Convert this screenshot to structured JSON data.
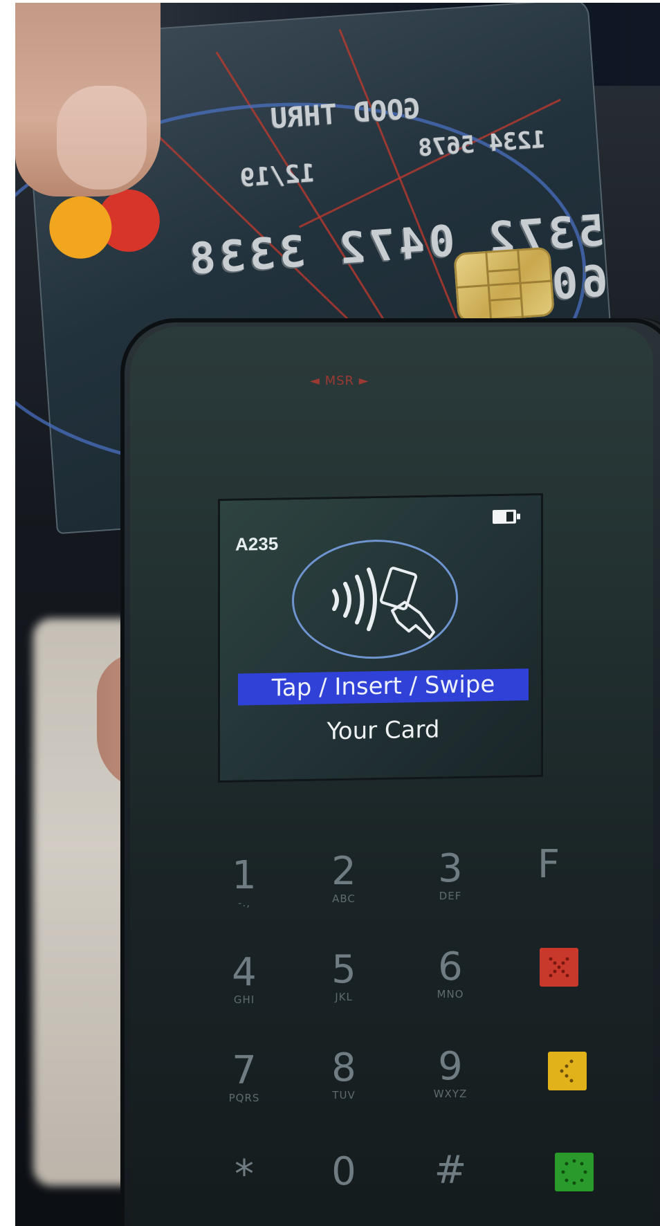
{
  "card": {
    "embossed_number": "5372 0472 3338 6071",
    "embossed_lines": [
      "GOOD THRU",
      "12/19",
      "1234 5678"
    ]
  },
  "terminal": {
    "msr_label": "◄ MSR ►",
    "screen": {
      "device_code": "A235",
      "prompt_line1": "Tap / Insert / Swipe",
      "prompt_line2": "Your Card"
    },
    "keypad": [
      {
        "digit": "1",
        "letters": "-.,"
      },
      {
        "digit": "2",
        "letters": "ABC"
      },
      {
        "digit": "3",
        "letters": "DEF"
      },
      {
        "digit": "F",
        "letters": ""
      },
      {
        "digit": "4",
        "letters": "GHI"
      },
      {
        "digit": "5",
        "letters": "JKL"
      },
      {
        "digit": "6",
        "letters": "MNO"
      },
      {
        "digit": "7",
        "letters": "PQRS"
      },
      {
        "digit": "8",
        "letters": "TUV"
      },
      {
        "digit": "9",
        "letters": "WXYZ"
      },
      {
        "digit": "*",
        "letters": ""
      },
      {
        "digit": "0",
        "letters": ""
      },
      {
        "digit": "#",
        "letters": ""
      }
    ],
    "function_keys": {
      "cancel_color": "#c8382b",
      "clear_color": "#e2b21a",
      "enter_color": "#2a9a2c"
    }
  }
}
